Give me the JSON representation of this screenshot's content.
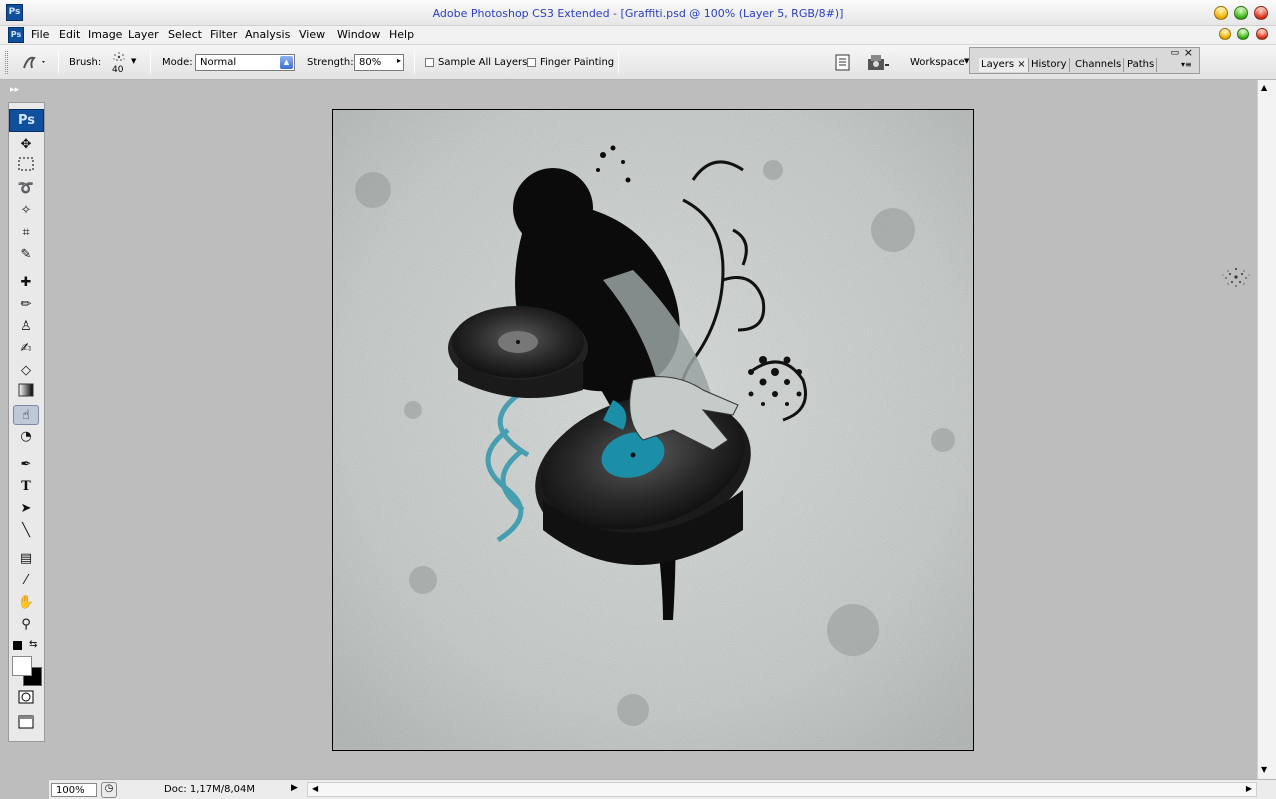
{
  "window": {
    "title": "Adobe Photoshop CS3 Extended - [Graffiti.psd @ 100% (Layer 5, RGB/8#)]",
    "app_icon": "Ps"
  },
  "menu": {
    "items": [
      {
        "label": "File"
      },
      {
        "label": "Edit"
      },
      {
        "label": "Image"
      },
      {
        "label": "Layer"
      },
      {
        "label": "Select"
      },
      {
        "label": "Filter"
      },
      {
        "label": "Analysis"
      },
      {
        "label": "View"
      },
      {
        "label": "Window"
      },
      {
        "label": "Help"
      }
    ]
  },
  "options": {
    "brush_label": "Brush:",
    "brush_size": "40",
    "mode_label": "Mode:",
    "mode_value": "Normal",
    "strength_label": "Strength:",
    "strength_value": "80%",
    "sample_all_layers": "Sample All Layers",
    "finger_painting": "Finger Painting",
    "workspace": "Workspace"
  },
  "panel_tabs": {
    "layers": "Layers",
    "history": "History",
    "channels": "Channels",
    "paths": "Paths",
    "close_glyph": "×"
  },
  "toolbox": {
    "logo": "Ps",
    "tools": [
      "move-tool",
      "marquee-tool",
      "lasso-tool",
      "magic-wand-tool",
      "crop-tool",
      "eyedropper-tool",
      "healing-brush-tool",
      "brush-tool",
      "clone-stamp-tool",
      "history-brush-tool",
      "eraser-tool",
      "gradient-tool",
      "smudge-tool",
      "dodge-tool",
      "pen-tool",
      "type-tool",
      "path-selection-tool",
      "line-tool",
      "notes-tool",
      "eyedropper-tool-2",
      "hand-tool",
      "zoom-tool"
    ],
    "active_tool": "smudge-tool",
    "type_glyph": "T"
  },
  "status": {
    "zoom": "100%",
    "doc": "Doc: 1,17M/8,04M"
  },
  "colors": {
    "title_text": "#2a3fbf",
    "accent_teal": "#1b8fa8"
  }
}
